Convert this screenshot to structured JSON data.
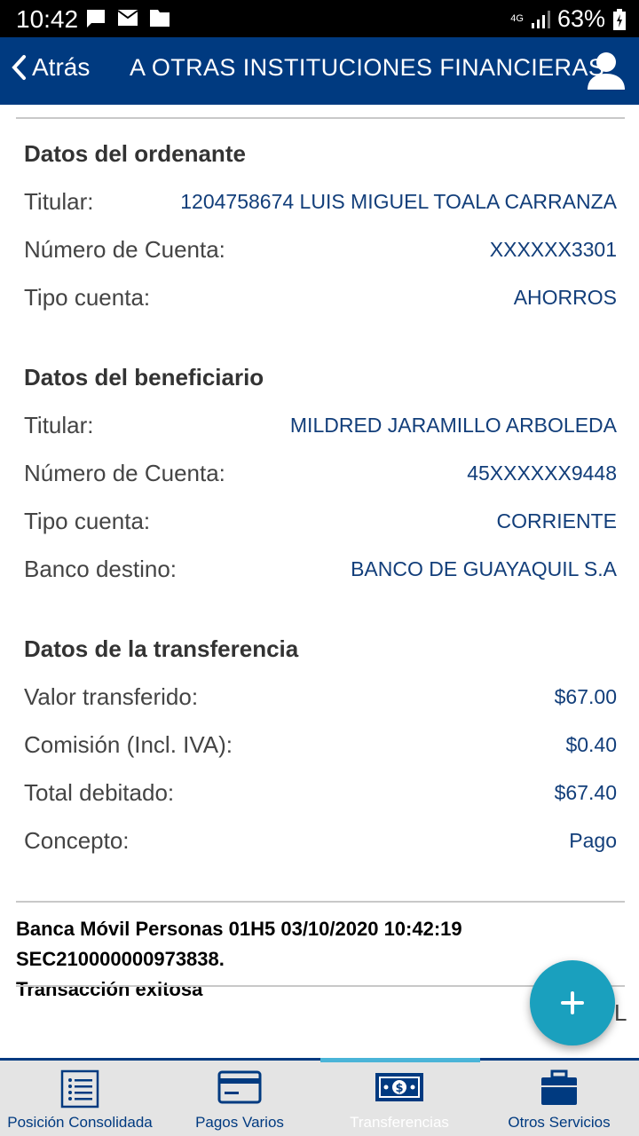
{
  "status_bar": {
    "time": "10:42",
    "network": "4G",
    "battery": "63%"
  },
  "header": {
    "back_label": "Atrás",
    "title": "A OTRAS INSTITUCIONES FINANCIERAS"
  },
  "ordenante": {
    "title": "Datos del ordenante",
    "rows": [
      {
        "label": "Titular:",
        "value": "1204758674 LUIS MIGUEL TOALA CARRANZA"
      },
      {
        "label": "Número de Cuenta:",
        "value": "XXXXXX3301"
      },
      {
        "label": "Tipo cuenta:",
        "value": "AHORROS"
      }
    ]
  },
  "beneficiario": {
    "title": "Datos del beneficiario",
    "rows": [
      {
        "label": "Titular:",
        "value": "MILDRED JARAMILLO ARBOLEDA"
      },
      {
        "label": "Número de Cuenta:",
        "value": "45XXXXXX9448"
      },
      {
        "label": "Tipo cuenta:",
        "value": "CORRIENTE"
      },
      {
        "label": "Banco destino:",
        "value": "BANCO DE GUAYAQUIL S.A"
      }
    ]
  },
  "transferencia": {
    "title": "Datos de la transferencia",
    "rows": [
      {
        "label": "Valor transferido:",
        "value": "$67.00"
      },
      {
        "label": "Comisión (Incl. IVA):",
        "value": "$0.40"
      },
      {
        "label": "Total debitado:",
        "value": "$67.40"
      },
      {
        "label": "Concepto:",
        "value": "Pago"
      }
    ]
  },
  "receipt": {
    "line1": "Banca Móvil Personas 01H5 03/10/2020 10:42:19 SEC210000000973838.",
    "line2": "Transacción exitosa"
  },
  "fab": {
    "partial_text": "L"
  },
  "bottom_nav": {
    "items": [
      {
        "label": "Posición Consolidada",
        "icon": "list-icon"
      },
      {
        "label": "Pagos Varios",
        "icon": "credit-card-icon"
      },
      {
        "label": "Transferencias",
        "icon": "cash-icon",
        "active": true
      },
      {
        "label": "Otros Servicios",
        "icon": "briefcase-icon"
      }
    ]
  },
  "colors": {
    "primary": "#003a80",
    "accent": "#1aa0be",
    "active_tab": "#4ab4d8",
    "value_text": "#123e7a"
  }
}
